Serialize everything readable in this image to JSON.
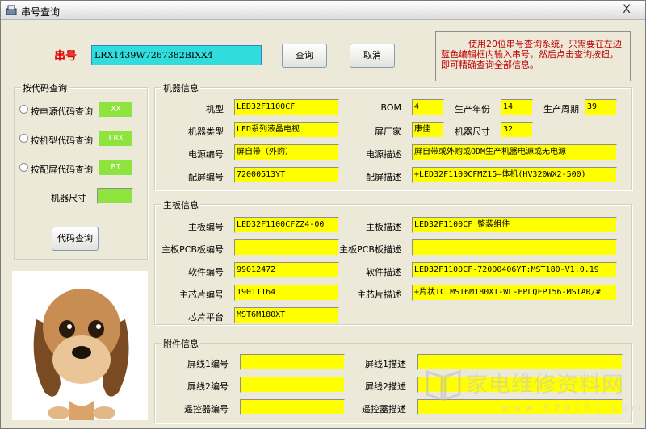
{
  "window": {
    "title": "串号查询",
    "close_label": "X"
  },
  "serial": {
    "label": "串号",
    "value": "LRX1439W7267382BIXX4",
    "query_button": "查询",
    "cancel_button": "取消"
  },
  "hint": "使用20位串号查询系统，只需要在左边蓝色编辑框内输入串号，然后点击查询按钮，即可精确查询全部信息。",
  "code_query": {
    "title": "按代码查询",
    "options": [
      {
        "label": "按电源代码查询",
        "value": "XX"
      },
      {
        "label": "按机型代码查询",
        "value": "LRX"
      },
      {
        "label": "按配屏代码查询",
        "value": "BI"
      }
    ],
    "size_label": "机器尺寸",
    "size_value": "",
    "button": "代码查询"
  },
  "machine": {
    "title": "机器信息",
    "model_label": "机型",
    "model": "LED32F1100CF",
    "bom_label": "BOM",
    "bom": "4",
    "year_label": "生产年份",
    "year": "14",
    "cycle_label": "生产周期",
    "cycle": "39",
    "type_label": "机器类型",
    "type": "LED系列液晶电视",
    "maker_label": "屏厂家",
    "maker": "康佳",
    "size_label": "机器尺寸",
    "size": "32",
    "power_no_label": "电源编号",
    "power_no": "屏自带（外购）",
    "power_desc_label": "电源描述",
    "power_desc": "屏自带或外购或ODM生产机器电源或无电源",
    "panel_no_label": "配屏编号",
    "panel_no": "72000513YT",
    "panel_desc_label": "配屏描述",
    "panel_desc": "+LED32F1100CFMZ15—体机(HV320WX2-500)"
  },
  "mainboard": {
    "title": "主板信息",
    "board_no_label": "主板编号",
    "board_no": "LED32F1100CFZZ4-00",
    "board_desc_label": "主板描述",
    "board_desc": "LED32F1100CF 整装组件",
    "pcb_no_label": "主板PCB板编号",
    "pcb_no": "",
    "pcb_desc_label": "主板PCB板描述",
    "pcb_desc": "",
    "sw_no_label": "软件编号",
    "sw_no": "99012472",
    "sw_desc_label": "软件描述",
    "sw_desc": "LED32F1100CF-72000406YT:MST180-V1.0.19",
    "chip_no_label": "主芯片编号",
    "chip_no": "19011164",
    "chip_desc_label": "主芯片描述",
    "chip_desc": "+片状IC MST6M180XT-WL-EPLQFP156-MSTAR/#",
    "platform_label": "芯片平台",
    "platform": "MST6M180XT"
  },
  "accessories": {
    "title": "附件信息",
    "cable1_no_label": "屏线1编号",
    "cable1_no": "",
    "cable1_desc_label": "屏线1描述",
    "cable1_desc": "",
    "cable2_no_label": "屏线2编号",
    "cable2_no": "",
    "cable2_desc_label": "屏线2描述",
    "cable2_desc": "",
    "remote_no_label": "遥控器编号",
    "remote_no": "",
    "remote_desc_label": "遥控器描述",
    "remote_desc": ""
  },
  "watermark": {
    "text": "家电维修资料网",
    "url": "www.520101.com"
  },
  "colors": {
    "field_yellow": "#ffff00",
    "field_green": "#8ee33d",
    "serial_cyan": "#30dcdc",
    "serial_label_red": "#e00000"
  }
}
